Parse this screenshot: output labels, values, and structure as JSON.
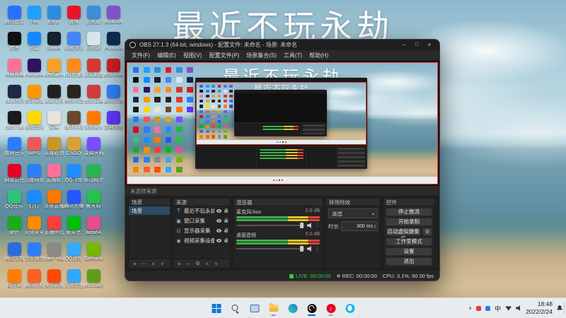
{
  "desktop": {
    "overlay_title": "最近不玩永劫",
    "icons": [
      {
        "label": "腾讯会议",
        "color": "#2970ff"
      },
      {
        "label": "剪映",
        "color": "#101010"
      },
      {
        "label": "哔哩哔哩",
        "color": "#fb7299"
      },
      {
        "label": "5E对战平台",
        "color": "#1e2746"
      },
      {
        "label": "OBS Studio",
        "color": "#1b1b1b"
      },
      {
        "label": "酷狗音乐",
        "color": "#2b7cff"
      },
      {
        "label": "网易云音乐",
        "color": "#e60026"
      },
      {
        "label": "QQ音乐",
        "color": "#31c27c"
      },
      {
        "label": "微信",
        "color": "#1aad19"
      },
      {
        "label": "腾讯文档",
        "color": "#2d6cdf"
      },
      {
        "label": "向日葵",
        "color": "#ff7d00"
      },
      {
        "label": "TIM",
        "color": "#20a0ff"
      },
      {
        "label": "迅雷",
        "color": "#1687ff"
      },
      {
        "label": "Premiere",
        "color": "#31125f"
      },
      {
        "label": "虎牙直播",
        "color": "#ff9600"
      },
      {
        "label": "酷我音乐",
        "color": "#ffd800"
      },
      {
        "label": "WPS",
        "color": "#eb5b56"
      },
      {
        "label": "百度网盘",
        "color": "#2d7ff9"
      },
      {
        "label": "钉钉",
        "color": "#1a8cff"
      },
      {
        "label": "火绒安全",
        "color": "#ff8a00"
      },
      {
        "label": "企业微信",
        "color": "#2e7fff"
      },
      {
        "label": "腾讯视频",
        "color": "#ff6022"
      },
      {
        "label": "Edge",
        "color": "#2b8de0"
      },
      {
        "label": "Steam",
        "color": "#17202d"
      },
      {
        "label": "WeGame",
        "color": "#f6a12a"
      },
      {
        "label": "永劫无间",
        "color": "#23201e"
      },
      {
        "label": "原神",
        "color": "#e8e4da"
      },
      {
        "label": "英雄联盟",
        "color": "#c8962c"
      },
      {
        "label": "直播姬",
        "color": "#fb7299"
      },
      {
        "label": "斗鱼直播",
        "color": "#ff7700"
      },
      {
        "label": "直播伴侣",
        "color": "#ff3b3b"
      },
      {
        "label": "ham_read",
        "color": "#8a8a8a"
      },
      {
        "label": "快手直播",
        "color": "#ff4906"
      },
      {
        "label": "微博",
        "color": "#e6162d"
      },
      {
        "label": "谷歌浏览器",
        "color": "#4285f4"
      },
      {
        "label": "UU加速器",
        "color": "#ff8a1e"
      },
      {
        "label": "黑色沙漠",
        "color": "#2a241f"
      },
      {
        "label": "骑马与砍杀",
        "color": "#6b4a2b"
      },
      {
        "label": "CSGO",
        "color": "#d9a036"
      },
      {
        "label": "QQ飞车",
        "color": "#1f8fff"
      },
      {
        "label": "腾讯先锋",
        "color": "#2456ff"
      },
      {
        "label": "爱奇艺",
        "color": "#00be06"
      },
      {
        "label": "QQ游戏",
        "color": "#38a8fa"
      },
      {
        "label": "迅游加速器",
        "color": "#2fa8ff"
      },
      {
        "label": "此电脑",
        "color": "#3a8fd6"
      },
      {
        "label": "回收站",
        "color": "#d9e4ee"
      },
      {
        "label": "网易邮箱",
        "color": "#d33a31"
      },
      {
        "label": "有道词典",
        "color": "#d23b3b"
      },
      {
        "label": "搜狗输入法",
        "color": "#ff7b00"
      },
      {
        "label": "录屏大师",
        "color": "#7b4dff"
      },
      {
        "label": "驱动精灵",
        "color": "#29b64f"
      },
      {
        "label": "鲁大师",
        "color": "#27c24c"
      },
      {
        "label": "aida64",
        "color": "#e84f8a"
      },
      {
        "label": "GeForce",
        "color": "#76b900"
      },
      {
        "label": "NVIDIA面板",
        "color": "#5f9e1a"
      },
      {
        "label": "WinRAR",
        "color": "#7d55c7"
      },
      {
        "label": "Photoshop",
        "color": "#0d2b4e"
      },
      {
        "label": "MSI Afterburner",
        "color": "#d02027"
      },
      {
        "label": "腾讯手游助手",
        "color": "#2f80ff"
      },
      {
        "label": "雷神加速器",
        "color": "#6236ff"
      }
    ]
  },
  "obs": {
    "title": "OBS 27.1.3 (64-bit, windows) - 配置文件: 未命名 - 场景: 未命名",
    "menus": [
      "文件(F)",
      "编辑(E)",
      "视图(V)",
      "配置文件(P)",
      "场景集合(S)",
      "工具(T)",
      "帮助(H)"
    ],
    "context_bar": "未选择来源",
    "docks": {
      "scenes": {
        "title": "场景",
        "items": [
          "场景"
        ]
      },
      "sources": {
        "title": "来源",
        "items": [
          {
            "name": "最近不玩永劫",
            "type": "text"
          },
          {
            "name": "窗口采集",
            "type": "window"
          },
          {
            "name": "显示器采集",
            "type": "display"
          },
          {
            "name": "视频采集设备",
            "type": "camera"
          }
        ]
      },
      "mixer": {
        "title": "混音器",
        "channels": [
          {
            "name": "麦克风/Aux",
            "db": "0.0 dB"
          },
          {
            "name": "桌面音频",
            "db": "0.0 dB"
          }
        ]
      },
      "transitions": {
        "title": "转场特效",
        "selected": "淡出",
        "duration_label": "时长",
        "duration_value": "300 ms"
      },
      "controls": {
        "title": "控件",
        "buttons": [
          "停止推流",
          "开始录制",
          "启动虚拟摄像机",
          "工作室模式",
          "设置",
          "退出"
        ]
      }
    },
    "status": {
      "live_label": "LIVE: 00:00:00",
      "rec_label": "REC: 00:00:00",
      "cpu": "CPU: 3.1%, 60.00 fps"
    }
  },
  "taskbar": {
    "icons": [
      {
        "name": "start"
      },
      {
        "name": "search"
      },
      {
        "name": "task-view"
      },
      {
        "name": "file-explorer",
        "open": true
      },
      {
        "name": "edge"
      },
      {
        "name": "obs",
        "open": true,
        "active": true
      },
      {
        "name": "netease-music",
        "open": true
      },
      {
        "name": "qq"
      }
    ],
    "tray": {
      "input_indicator": "中",
      "time": "18:48",
      "date": "2022/2/24"
    }
  },
  "colors": {
    "selection_red": "#ff3b30",
    "live_green": "#2ecc40",
    "meter_green": "#3fae4a",
    "meter_yellow": "#e6c229",
    "meter_red": "#d9453a",
    "taskbar_accent": "#0067c0"
  }
}
